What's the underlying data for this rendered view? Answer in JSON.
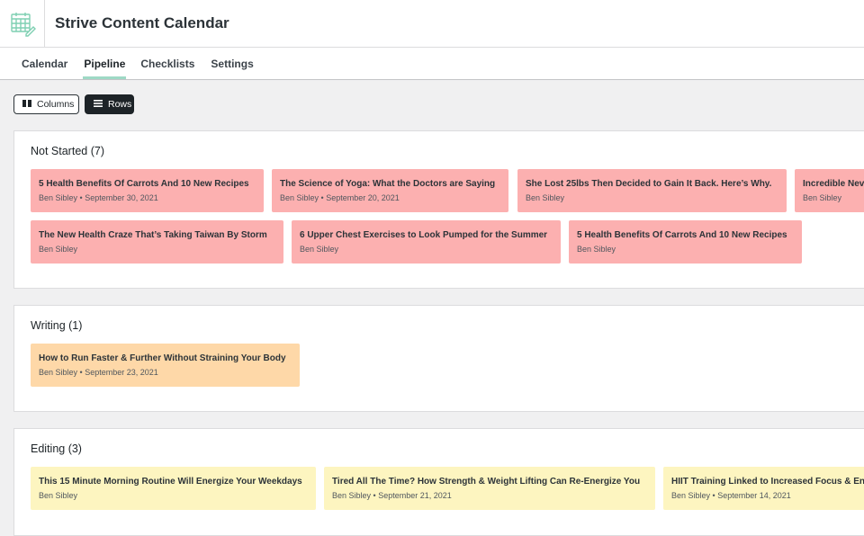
{
  "app": {
    "title": "Strive Content Calendar"
  },
  "tabs": [
    {
      "label": "Calendar"
    },
    {
      "label": "Pipeline"
    },
    {
      "label": "Checklists"
    },
    {
      "label": "Settings"
    }
  ],
  "active_tab": "Pipeline",
  "view_toggle": {
    "columns_label": "Columns",
    "rows_label": "Rows",
    "active": "Rows"
  },
  "sections": [
    {
      "title": "Not Started (7)",
      "color": "#fcb0b0",
      "cards": [
        {
          "title": "5 Health Benefits Of Carrots And 10 New Recipes",
          "author": "Ben Sibley",
          "date": "September 30, 2021"
        },
        {
          "title": "The Science of Yoga: What the Doctors are Saying",
          "author": "Ben Sibley",
          "date": "September 20, 2021"
        },
        {
          "title": "She Lost 25lbs Then Decided to Gain It Back. Here’s Why.",
          "author": "Ben Sibley",
          "date": ""
        },
        {
          "title": "Incredible Nev",
          "author": "Ben Sibley",
          "date": ""
        },
        {
          "title": "The New Health Craze That’s Taking Taiwan By Storm",
          "author": "Ben Sibley",
          "date": ""
        },
        {
          "title": "6 Upper Chest Exercises to Look Pumped for the Summer",
          "author": "Ben Sibley",
          "date": ""
        },
        {
          "title": "5 Health Benefits Of Carrots And 10 New Recipes",
          "author": "Ben Sibley",
          "date": ""
        }
      ]
    },
    {
      "title": "Writing (1)",
      "color": "#fed8a8",
      "cards": [
        {
          "title": "How to Run Faster & Further Without Straining Your Body",
          "author": "Ben Sibley",
          "date": "September 23, 2021"
        }
      ]
    },
    {
      "title": "Editing (3)",
      "color": "#fdf5c0",
      "cards": [
        {
          "title": "This 15 Minute Morning Routine Will Energize Your Weekdays",
          "author": "Ben Sibley",
          "date": ""
        },
        {
          "title": "Tired All The Time? How Strength & Weight Lifting Can Re-Energize You",
          "author": "Ben Sibley",
          "date": "September 21, 2021"
        },
        {
          "title": "HIIT Training Linked to Increased Focus & En",
          "author": "Ben Sibley",
          "date": "September 14, 2021"
        }
      ]
    }
  ],
  "icons": {
    "logo": "calendar-edit-icon",
    "columns": "columns-icon",
    "rows": "rows-icon"
  }
}
